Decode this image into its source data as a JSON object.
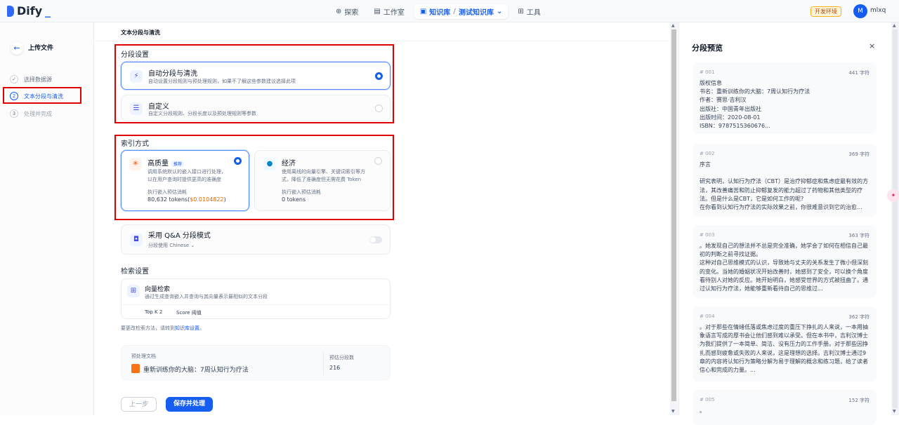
{
  "header": {
    "logo": "Dify",
    "nav": {
      "explore": "探索",
      "studio": "工作室",
      "datasets": "知识库",
      "current_dataset": "测试知识库",
      "tools": "工具"
    },
    "env_badge": "开发环境",
    "avatar": "M",
    "username": "mlxq"
  },
  "sidebar": {
    "title": "上传文件",
    "steps": [
      {
        "num": "1",
        "label": "选择数据源"
      },
      {
        "num": "2",
        "label": "文本分段与清洗"
      },
      {
        "num": "3",
        "label": "处理并完成"
      }
    ]
  },
  "main": {
    "section_title": "文本分段与清洗",
    "segment": {
      "heading": "分段设置",
      "auto": {
        "title": "自动分段与清洗",
        "desc": "自动设置分段规则与预处理规则，如果不了解这些参数建议选择此项"
      },
      "custom": {
        "title": "自定义",
        "desc": "自定义分段规则、分段长度以及预处理规则等参数"
      }
    },
    "index": {
      "heading": "索引方式",
      "high": {
        "title": "高质量",
        "badge": "推荐",
        "desc1": "调用系统默认的嵌入接口进行处理，",
        "desc2": "以在用户查询时提供更高的准确度",
        "est_label": "执行嵌入预估消耗",
        "tokens": "80,632 tokens(",
        "price": "$0.0104822",
        "close": ")"
      },
      "eco": {
        "title": "经济",
        "desc1": "使用离线的向量引擎、关键词索引等方",
        "desc2": "式，降低了准确度但无需花费 Token",
        "est_label": "执行嵌入预估消耗",
        "tokens": "0 tokens"
      }
    },
    "qa": {
      "title": "采用 Q&A 分段模式",
      "lang": "分段使用 Chinese"
    },
    "retrieval": {
      "heading": "检索设置",
      "title": "向量检索",
      "desc": "通过生成查询嵌入并查询与其向量表示最相似的文本分段",
      "topk": "Top K 2",
      "score": "Score 阈值",
      "hint_prefix": "要更改检索方法，请转到",
      "hint_link": "知识库设置",
      "hint_suffix": "。"
    },
    "doc": {
      "label": "预处理文档",
      "name": "重新训练你的大脑：7周认知行为疗法",
      "count_label": "预估分段数",
      "count": "216"
    },
    "buttons": {
      "prev": "上一步",
      "save": "保存并处理"
    }
  },
  "preview": {
    "title": "分段预览",
    "chunks": [
      {
        "id": "# 001",
        "count": "441 字符",
        "text": "版权信息\n书名：重新训练你的大脑：7周认知行为疗法\n作者：赛思·吉利汉\n出版社：中国青年出版社\n出版时间：2020-08-01\nISBN：9787515360676..."
      },
      {
        "id": "# 002",
        "count": "369 字符",
        "text": "序言\n\n研究表明，认知行为疗法（CBT）是治疗抑郁症和焦虑症最有效的方法，其改善痛苦和防止抑郁复发的能力超过了药物和其他类型的疗法。但是什么是CBT，它是如何工作的呢?\n在你看到认知行为疗法的实际效果之前，你很难意识到它的治愈..."
      },
      {
        "id": "# 003",
        "count": "363 字符",
        "text": "。她发现自己的想法并不总是完全准确，她学会了如何在相信自己最初的判断之前寻找证据。\n这种对自己思维模式的认识，导致她与丈夫的关系发生了微小但深刻的变化。当她的婚姻状况开始改善时，她感到了安全，可以换个角度看待别人对她的反应。她开始明白，她感受世界的方式被扭曲了。通过认知行为疗法，她能够重新看待自己的思维过..."
      },
      {
        "id": "# 004",
        "count": "362 字符",
        "text": "。对于那些在情绪低落或焦虑过度的重压下挣扎的人来说，一本用抽象语言写成的厚书会让他们感到难以承受。但在本书中，吉利汉博士为我们提供了一本简单、简洁、没有压力的工作手册。对于那些因挣扎而感到疲惫或失败的人来说，这是理想的选择。吉利汉博士通过9章的内容将认知行为策略分解为易于理解的概念和练习题，给了读者信心和完成的力量。..."
      },
      {
        "id": "# 005",
        "count": "152 字符",
        "text": "。"
      }
    ]
  }
}
